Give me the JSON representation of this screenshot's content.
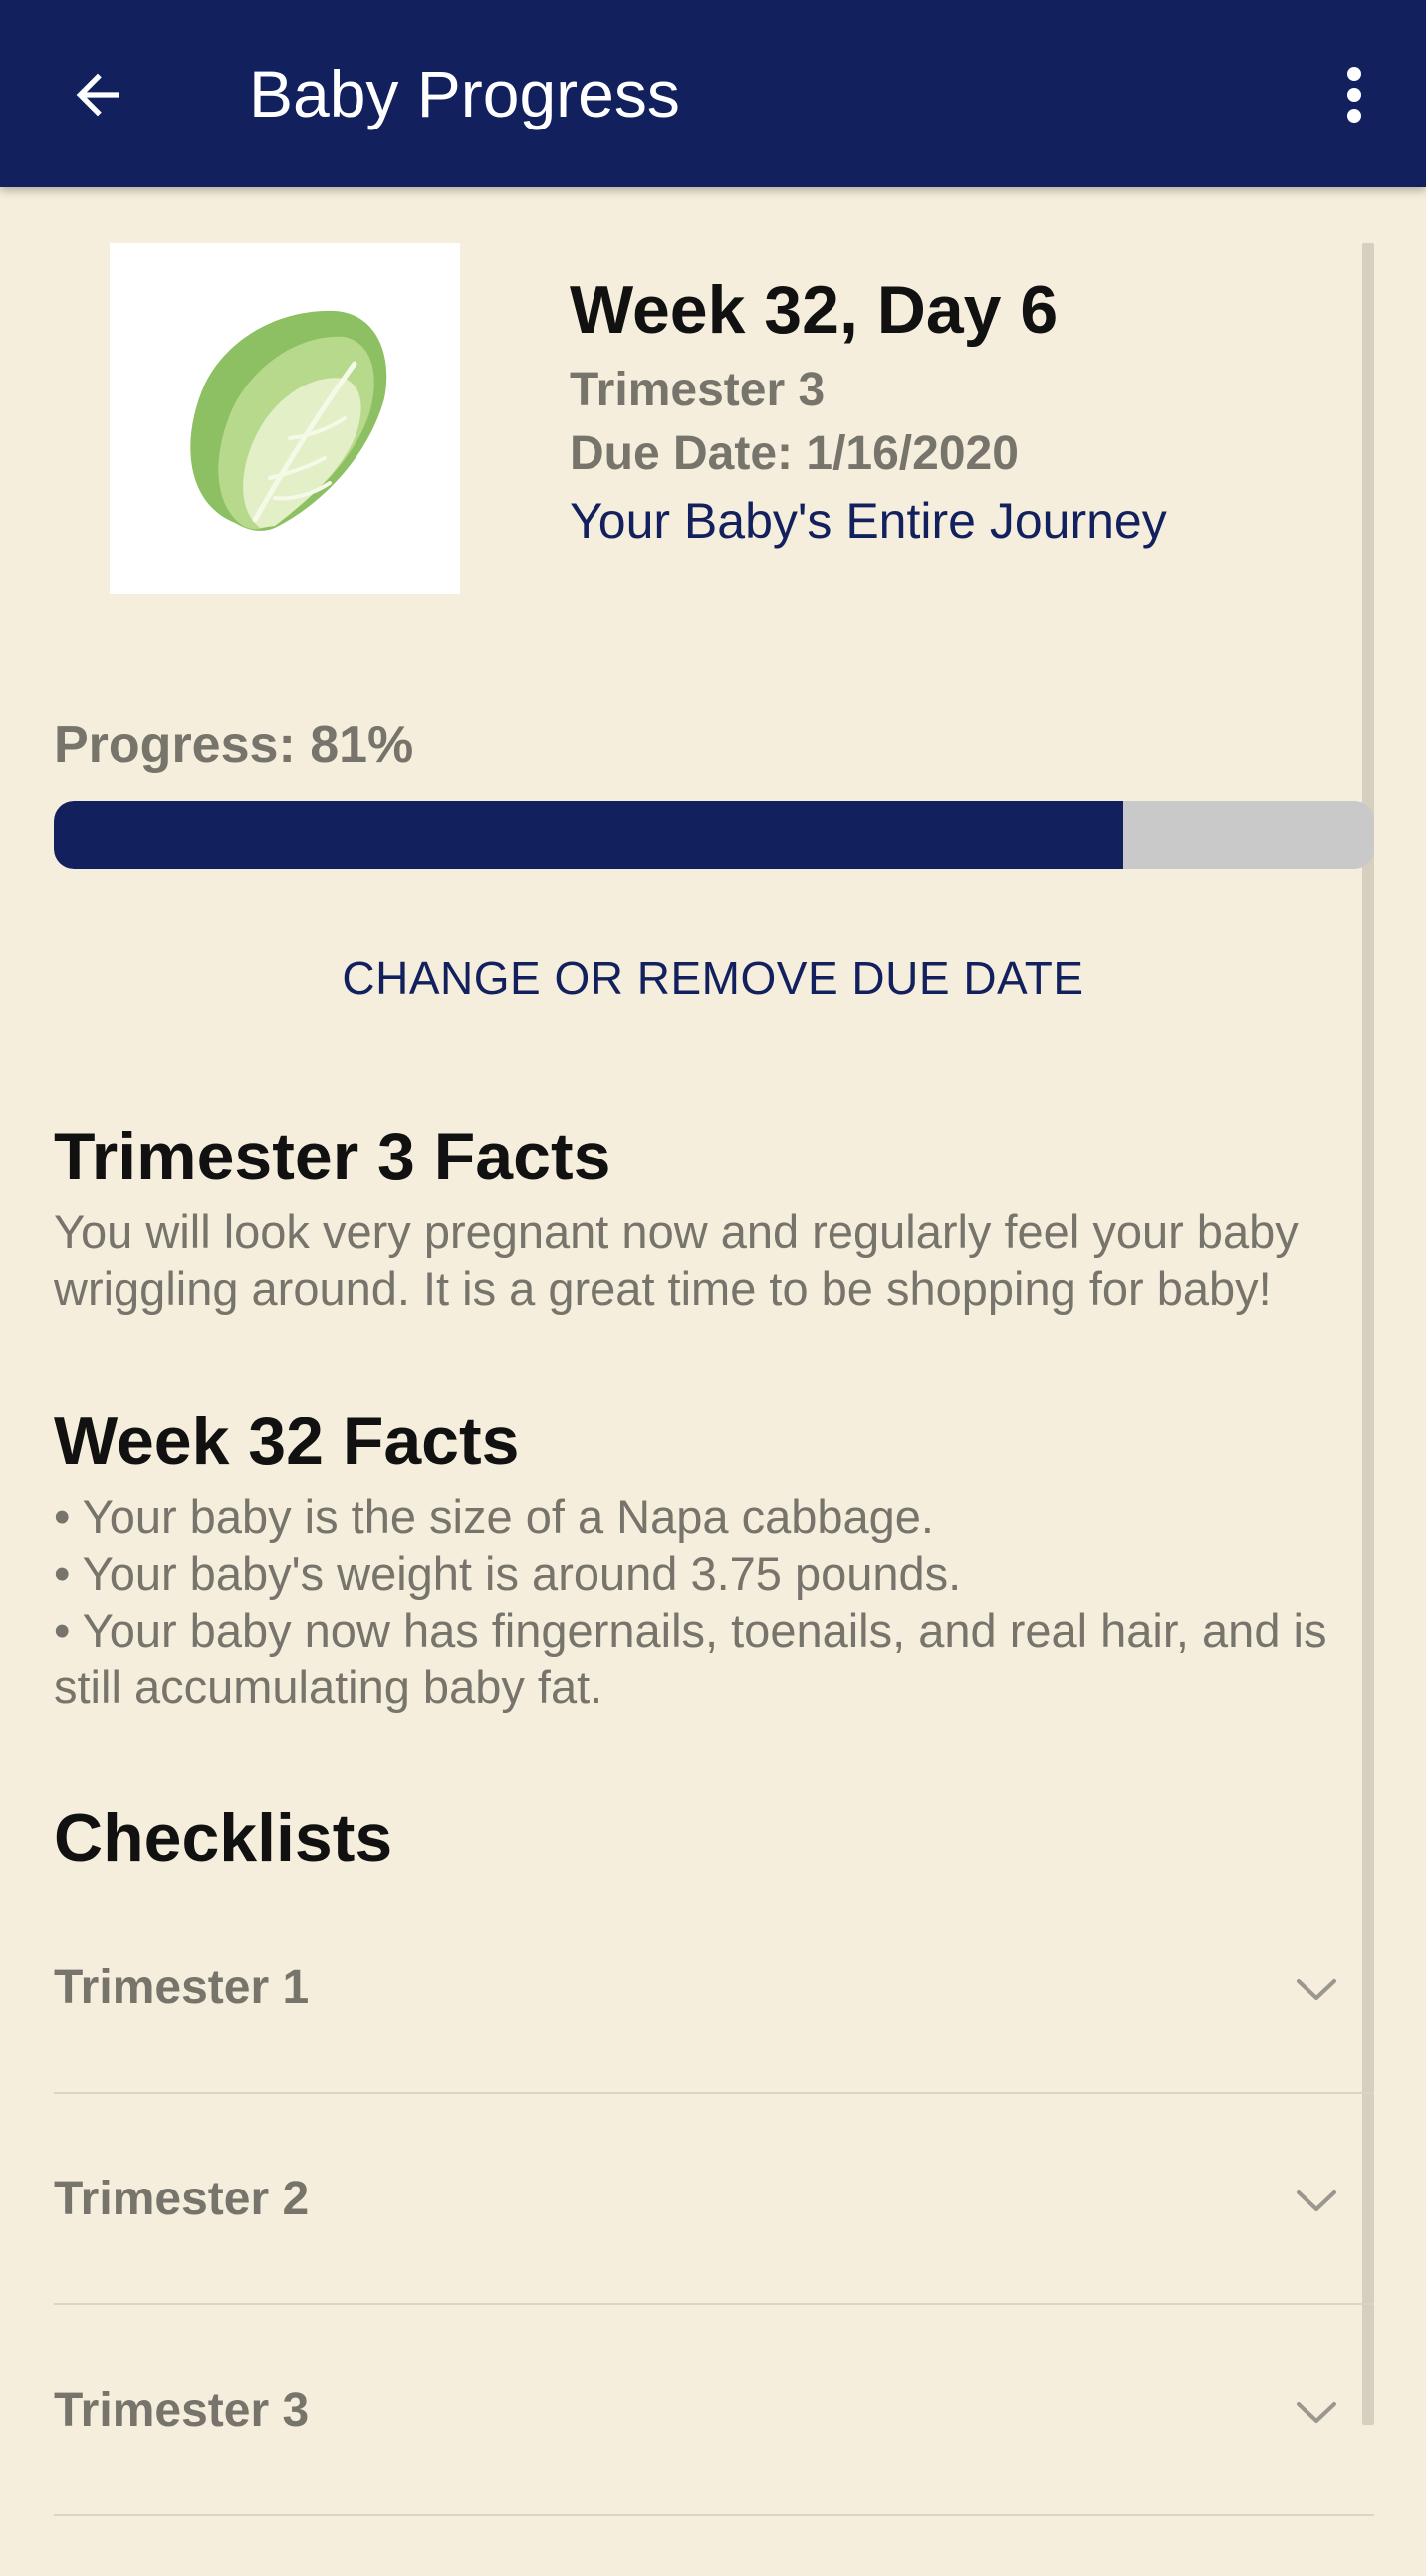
{
  "appbar": {
    "title": "Baby Progress",
    "back_icon": "arrow-left-icon",
    "menu_icon": "more-vertical-icon"
  },
  "summary": {
    "image_icon": "napa-cabbage-illustration",
    "week_title": "Week 32, Day 6",
    "trimester": "Trimester 3",
    "due_date": "Due Date: 1/16/2020",
    "journey_link": "Your Baby's Entire Journey"
  },
  "progress": {
    "label": "Progress: 81%",
    "value_percent": 81
  },
  "change_due_date_label": "CHANGE OR REMOVE DUE DATE",
  "trimester_facts": {
    "heading": "Trimester 3 Facts",
    "text": "You will look very pregnant now and regularly feel your baby wriggling around. It is a great time to be shopping for baby!"
  },
  "week_facts": {
    "heading": "Week 32 Facts",
    "items": [
      "• Your baby is the size of a Napa cabbage.",
      "• Your baby's weight is around 3.75 pounds.",
      "• Your baby now has fingernails, toenails, and real hair, and is still accumulating baby fat."
    ]
  },
  "checklists": {
    "heading": "Checklists",
    "items": [
      {
        "label": "Trimester 1",
        "icon": "chevron-down-icon"
      },
      {
        "label": "Trimester 2",
        "icon": "chevron-down-icon"
      },
      {
        "label": "Trimester 3",
        "icon": "chevron-down-icon"
      }
    ]
  },
  "colors": {
    "primary": "#12205E",
    "background": "#F5EEDC",
    "muted_text": "#76746B",
    "progress_track": "#C9C9C9"
  }
}
